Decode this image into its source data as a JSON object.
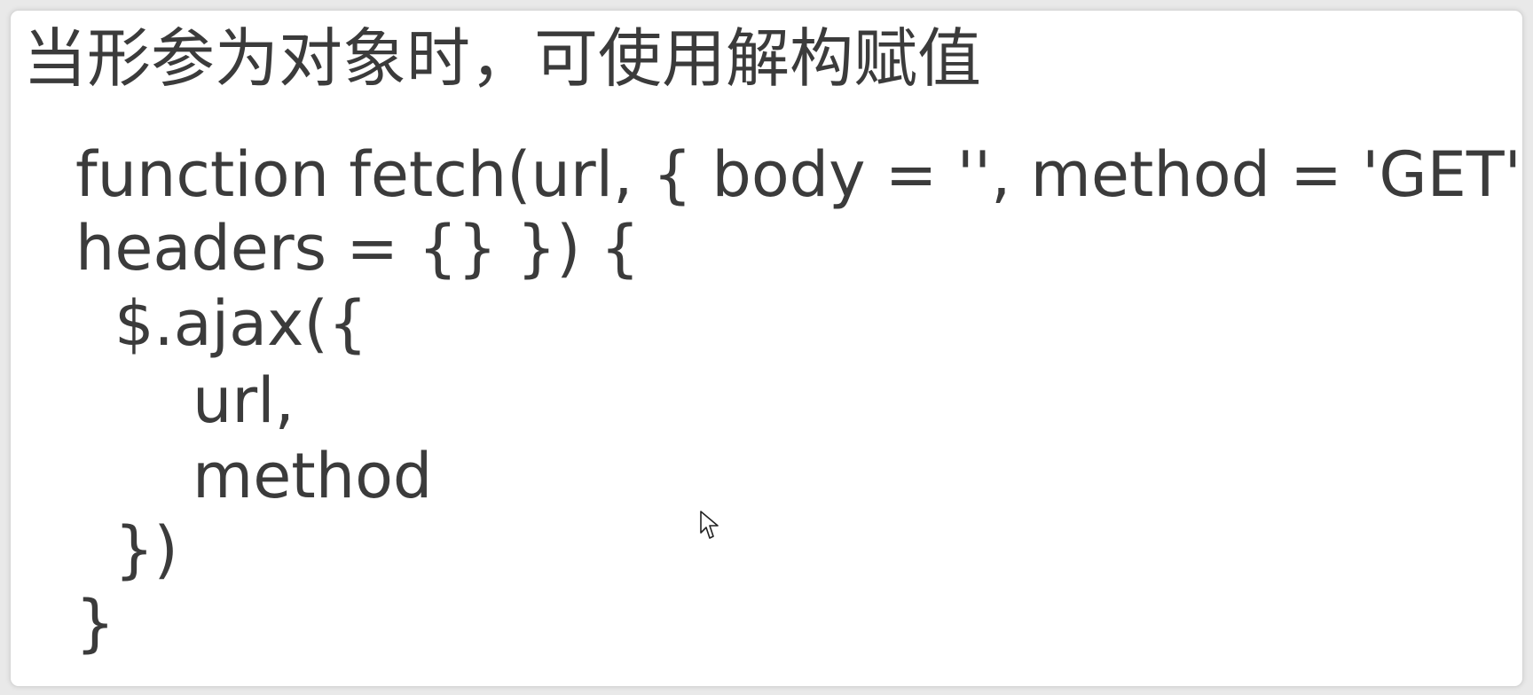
{
  "heading": "当形参为对象时，可使用解构赋值",
  "code_lines": [
    "function fetch(url, { body = '', method = 'GET',",
    "headers = {} }) {",
    "$.ajax({",
    "url,",
    "method",
    "})",
    "}"
  ]
}
